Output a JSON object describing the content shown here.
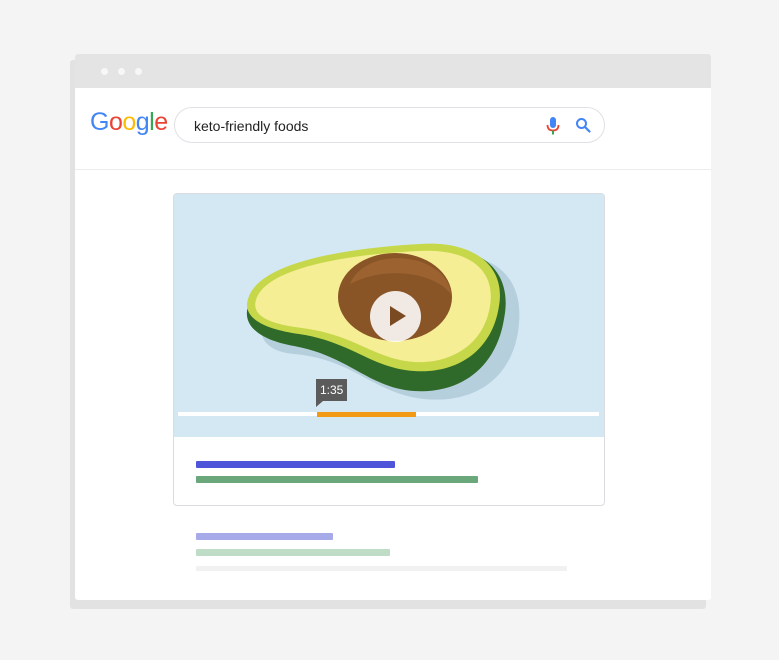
{
  "window": {
    "titlebar_dots": [
      "close-dot",
      "minimize-dot",
      "maximize-dot"
    ]
  },
  "header": {
    "logo_letters": [
      {
        "char": "G",
        "color": "#4285F4"
      },
      {
        "char": "o",
        "color": "#EA4335"
      },
      {
        "char": "o",
        "color": "#FBBC05"
      },
      {
        "char": "g",
        "color": "#4285F4"
      },
      {
        "char": "l",
        "color": "#34A853"
      },
      {
        "char": "e",
        "color": "#EA4335"
      }
    ],
    "search": {
      "query": "keto-friendly foods",
      "mic_icon": "microphone-icon",
      "search_icon": "magnifier-icon"
    }
  },
  "video_result": {
    "thumbnail_icon": "avocado-illustration",
    "timestamp": "1:35",
    "progress": {
      "key_moment_start_fraction": 0.34,
      "key_moment_end_fraction": 0.57
    },
    "colors": {
      "title_bar": "#4f55d8",
      "url_bar": "#6aa77a",
      "progress": "#f29a16"
    }
  },
  "second_result": {
    "colors": {
      "title_bar": "#a7aae9",
      "url_bar": "#bfdcc6"
    }
  }
}
